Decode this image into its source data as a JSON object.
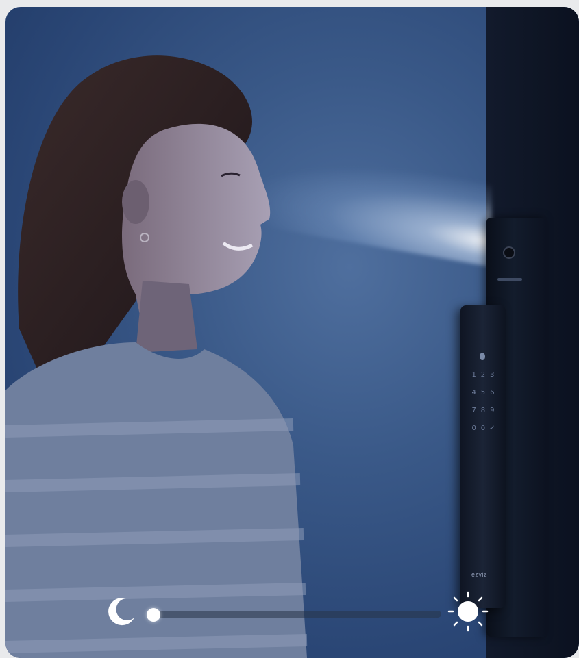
{
  "image": {
    "keypad": [
      "1",
      "2",
      "3",
      "4",
      "5",
      "6",
      "7",
      "8",
      "9",
      "0",
      "0",
      "✓"
    ],
    "brand_logo": "ezviz"
  },
  "slider": {
    "value": 0,
    "left_icon": "moon-icon",
    "right_icon": "sun-icon"
  },
  "colors": {
    "background": "#2a4675",
    "lock": "#0e1524",
    "accent": "#ffffff"
  }
}
